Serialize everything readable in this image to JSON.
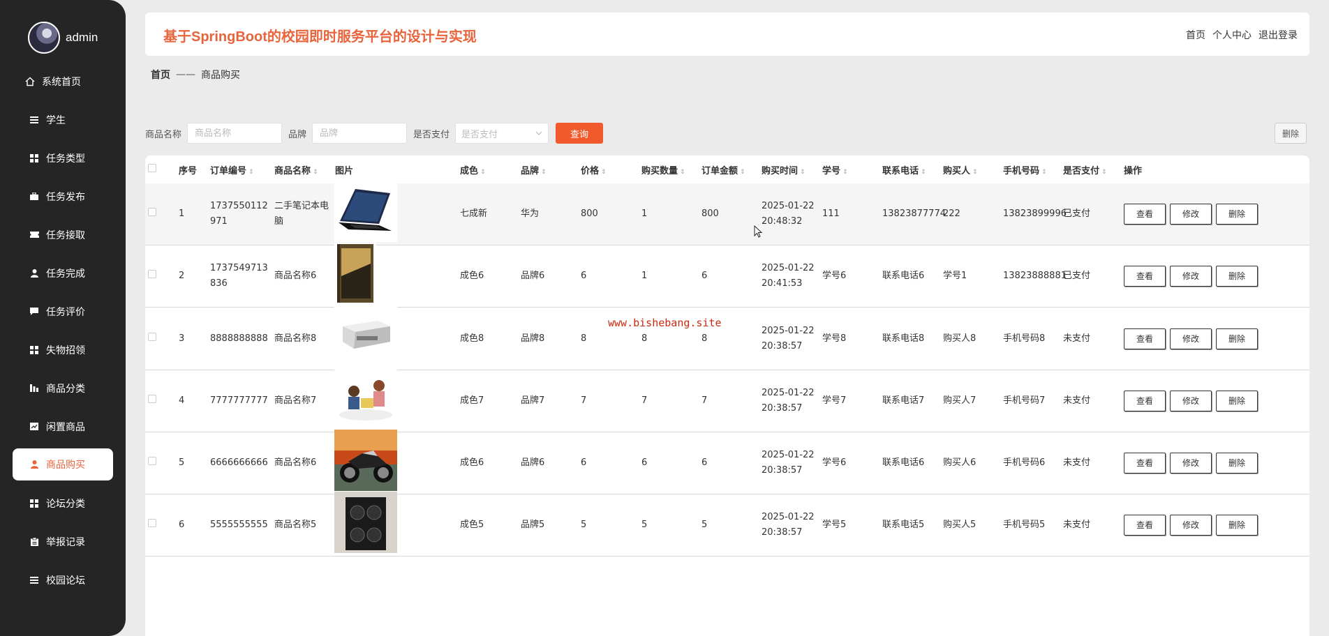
{
  "sidebar": {
    "user_name": "admin",
    "items": [
      {
        "label": "系统首页",
        "icon": "home-icon"
      },
      {
        "label": "学生",
        "icon": "list-icon"
      },
      {
        "label": "任务类型",
        "icon": "grid-icon"
      },
      {
        "label": "任务发布",
        "icon": "briefcase-icon"
      },
      {
        "label": "任务接取",
        "icon": "ticket-icon"
      },
      {
        "label": "任务完成",
        "icon": "user-icon"
      },
      {
        "label": "任务评价",
        "icon": "comment-icon"
      },
      {
        "label": "失物招领",
        "icon": "grid-icon"
      },
      {
        "label": "商品分类",
        "icon": "chart-icon"
      },
      {
        "label": "闲置商品",
        "icon": "chart-line-icon"
      },
      {
        "label": "商品购买",
        "icon": "user-icon",
        "active": true
      },
      {
        "label": "论坛分类",
        "icon": "grid-icon"
      },
      {
        "label": "举报记录",
        "icon": "clipboard-icon"
      },
      {
        "label": "校园论坛",
        "icon": "list-icon"
      }
    ]
  },
  "header": {
    "title": "基于SpringBoot的校园即时服务平台的设计与实现",
    "links": [
      "首页",
      "个人中心",
      "退出登录"
    ]
  },
  "breadcrumb": {
    "home": "首页",
    "sep": "——",
    "current": "商品购买"
  },
  "search": {
    "name_label": "商品名称",
    "name_placeholder": "商品名称",
    "brand_label": "品牌",
    "brand_placeholder": "品牌",
    "paid_label": "是否支付",
    "paid_placeholder": "是否支付",
    "search_button": "查询",
    "delete_button": "删除"
  },
  "table": {
    "columns": [
      "序号",
      "订单编号",
      "商品名称",
      "图片",
      "成色",
      "品牌",
      "价格",
      "购买数量",
      "订单金额",
      "购买时间",
      "学号",
      "联系电话",
      "购买人",
      "手机号码",
      "是否支付",
      "操作"
    ],
    "rows": [
      {
        "no": "1",
        "order": "1737550112971",
        "name": "二手笔记本电脑",
        "image": "laptop",
        "cond": "七成新",
        "brand": "华为",
        "price": "800",
        "qty": "1",
        "amount": "800",
        "time": "2025-01-22 20:48:32",
        "sid": "111",
        "phone": "13823877774",
        "buyer": "222",
        "mobile": "13823899996",
        "paid": "已支付"
      },
      {
        "no": "2",
        "order": "1737549713836",
        "name": "商品名称6",
        "image": "book",
        "cond": "成色6",
        "brand": "品牌6",
        "price": "6",
        "qty": "1",
        "amount": "6",
        "time": "2025-01-22 20:41:53",
        "sid": "学号6",
        "phone": "联系电话6",
        "buyer": "学号1",
        "mobile": "13823888881",
        "paid": "已支付"
      },
      {
        "no": "3",
        "order": "8888888888",
        "name": "商品名称8",
        "image": "printer",
        "cond": "成色8",
        "brand": "品牌8",
        "price": "8",
        "qty": "8",
        "amount": "8",
        "time": "2025-01-22 20:38:57",
        "sid": "学号8",
        "phone": "联系电话8",
        "buyer": "购买人8",
        "mobile": "手机号码8",
        "paid": "未支付"
      },
      {
        "no": "4",
        "order": "7777777777",
        "name": "商品名称7",
        "image": "kids",
        "cond": "成色7",
        "brand": "品牌7",
        "price": "7",
        "qty": "7",
        "amount": "7",
        "time": "2025-01-22 20:38:57",
        "sid": "学号7",
        "phone": "联系电话7",
        "buyer": "购买人7",
        "mobile": "手机号码7",
        "paid": "未支付"
      },
      {
        "no": "5",
        "order": "6666666666",
        "name": "商品名称6",
        "image": "motorcycle",
        "cond": "成色6",
        "brand": "品牌6",
        "price": "6",
        "qty": "6",
        "amount": "6",
        "time": "2025-01-22 20:38:57",
        "sid": "学号6",
        "phone": "联系电话6",
        "buyer": "购买人6",
        "mobile": "手机号码6",
        "paid": "未支付"
      },
      {
        "no": "6",
        "order": "5555555555",
        "name": "商品名称5",
        "image": "speaker",
        "cond": "成色5",
        "brand": "品牌5",
        "price": "5",
        "qty": "5",
        "amount": "5",
        "time": "2025-01-22 20:38:57",
        "sid": "学号5",
        "phone": "联系电话5",
        "buyer": "购买人5",
        "mobile": "手机号码5",
        "paid": "未支付"
      }
    ],
    "ops": [
      "查看",
      "修改",
      "删除"
    ]
  },
  "watermark": "www.bishebang.site"
}
